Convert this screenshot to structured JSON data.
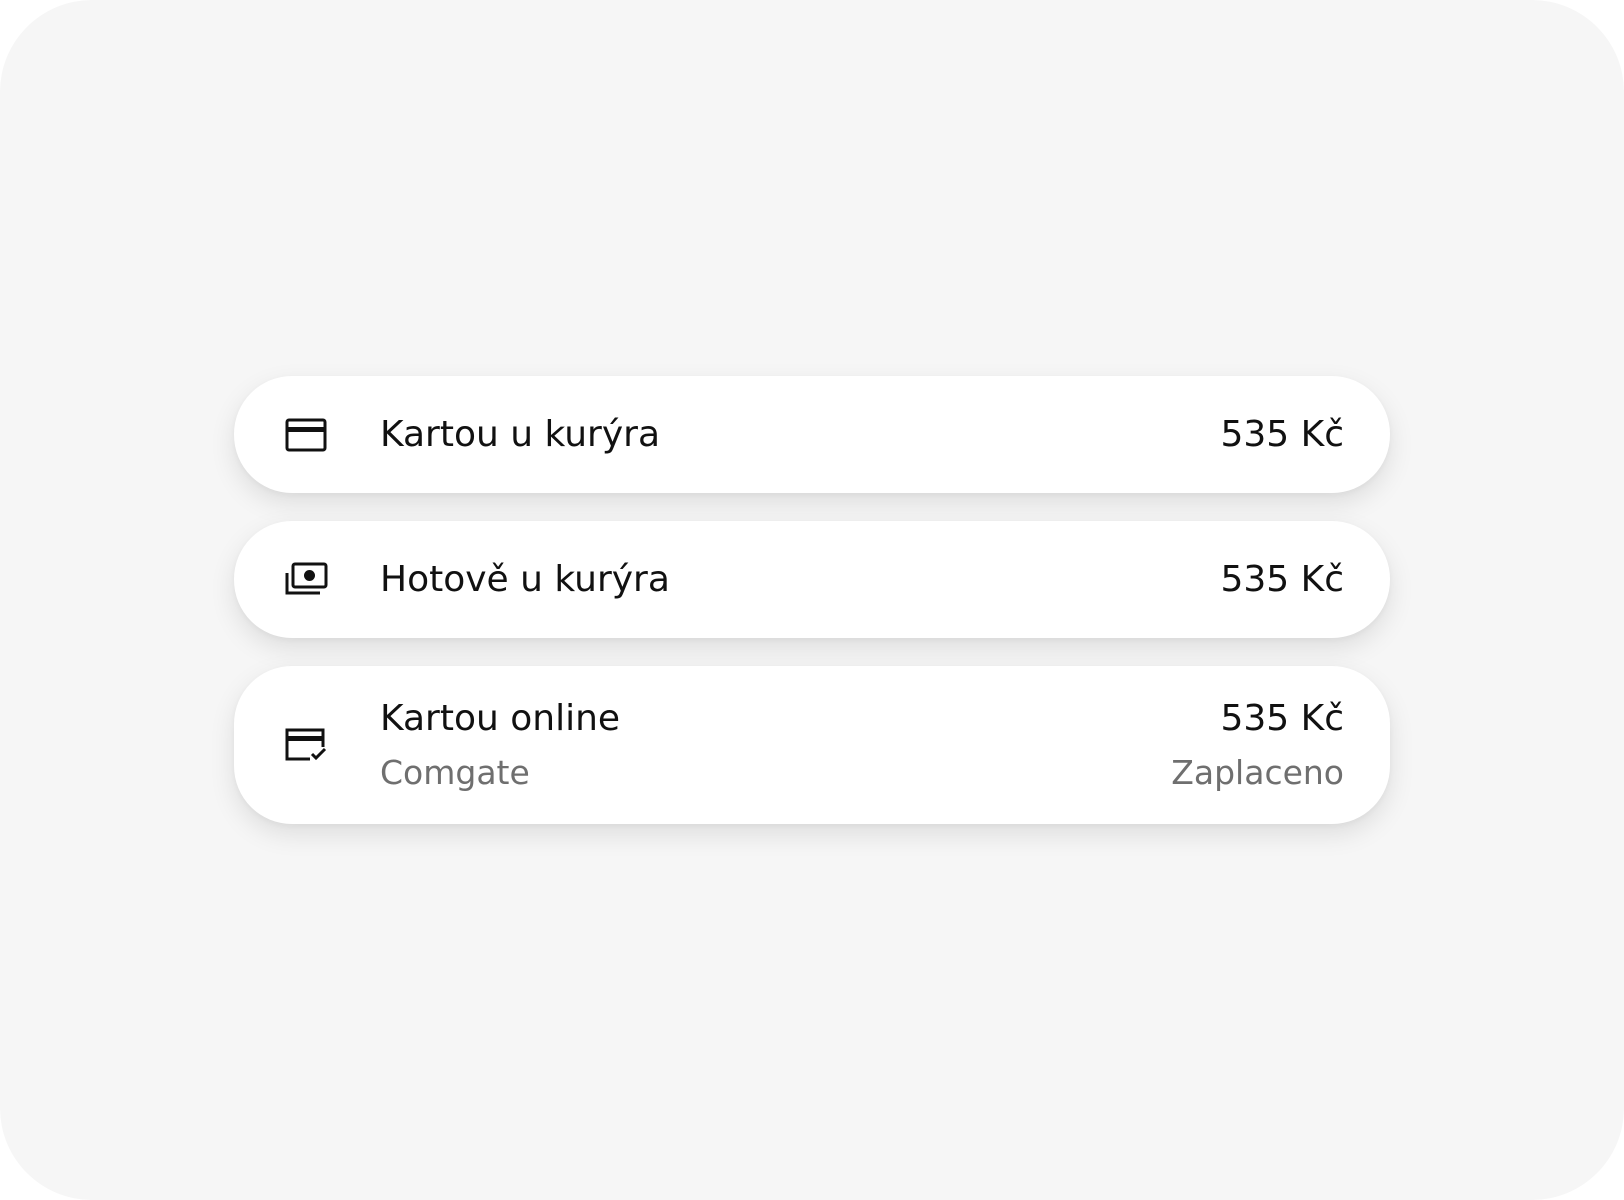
{
  "payment_methods": [
    {
      "icon": "credit-card-icon",
      "label": "Kartou u kurýra",
      "amount": "535 Kč"
    },
    {
      "icon": "cash-stack-icon",
      "label": "Hotově u kurýra",
      "amount": "535 Kč"
    },
    {
      "icon": "card-checkmark-icon",
      "label": "Kartou online",
      "provider": "Comgate",
      "amount": "535 Kč",
      "status": "Zaplaceno"
    }
  ],
  "colors": {
    "background": "#f6f6f6",
    "card": "#ffffff",
    "primary_text": "#111111",
    "secondary_text": "#6f6f6f"
  }
}
